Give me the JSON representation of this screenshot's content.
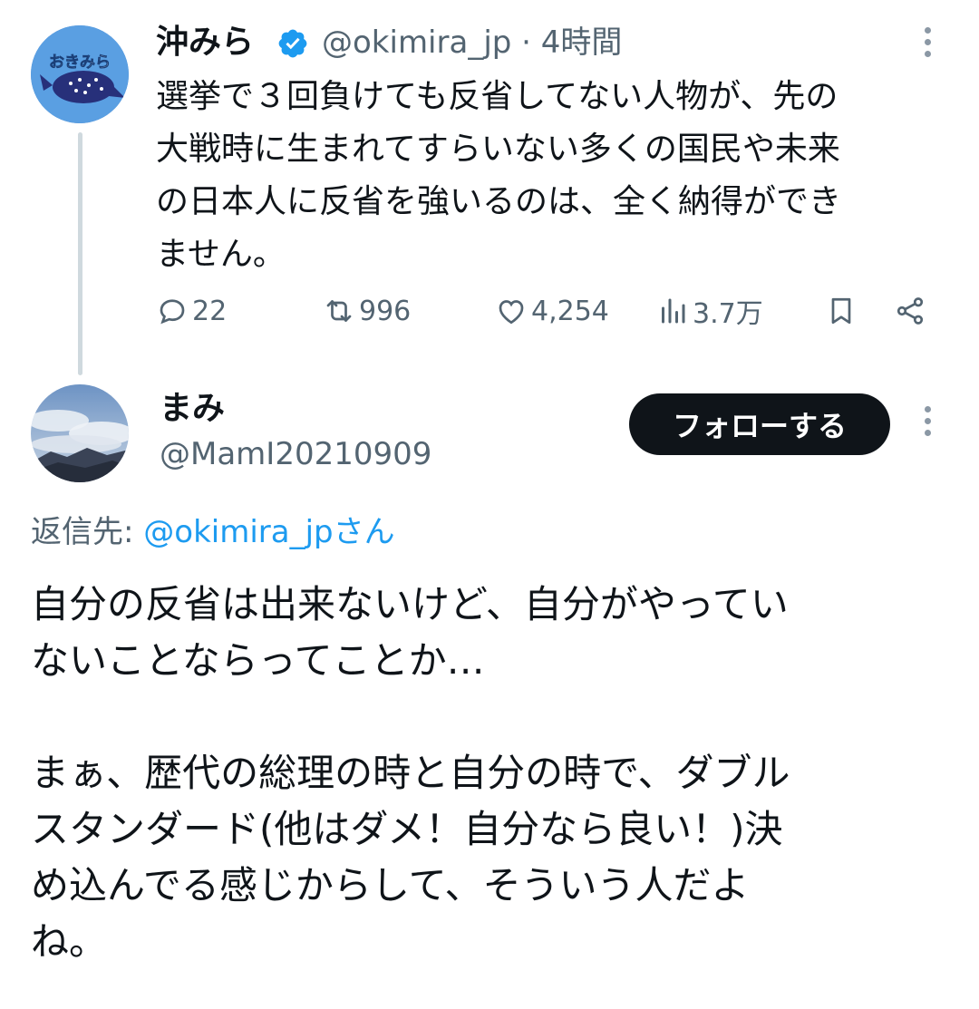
{
  "tweet1": {
    "author_name": "沖みら",
    "verified": true,
    "handle_time": "@okimira_jp · 4時間",
    "avatar_text": "おきみら",
    "text": "選挙で３回負けても反省してない人物が、先の\n大戦時に生まれてすらいない多くの国民や未来\nの日本人に反省を強いるのは、全く納得ができ\nません。",
    "actions": {
      "replies": "22",
      "retweets": "996",
      "likes": "4,254",
      "views": "3.7万"
    }
  },
  "tweet2": {
    "author_name": "まみ",
    "handle": "@MamI20210909",
    "follow_label": "フォローする",
    "reply_to_prefix": "返信先: ",
    "reply_to_mention": "@okimira_jpさん",
    "text": "自分の反省は出来ないけど、自分がやってい\nないことならってことか…\n\nまぁ、歴代の総理の時と自分の時で、ダブル\nスタンダード(他はダメ！自分なら良い！)決\nめ込んでる感じからして、そういう人だよ\nね。"
  },
  "colors": {
    "text": "#0f1419",
    "secondary": "#536471",
    "accent": "#1d9bf0",
    "thread_line": "#cfd9de"
  },
  "icons": [
    "reply-icon",
    "retweet-icon",
    "like-icon",
    "views-icon",
    "bookmark-icon",
    "share-icon",
    "more-icon",
    "verified-icon"
  ]
}
